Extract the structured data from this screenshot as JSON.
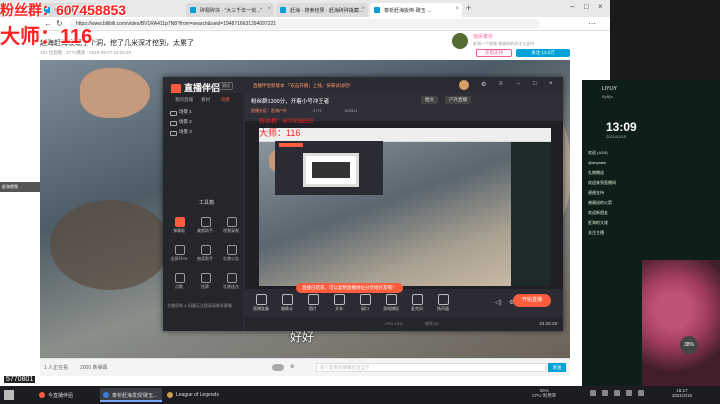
{
  "overlay": {
    "fans_text": "粉丝群：607458853",
    "master_text": "大师：116"
  },
  "browser": {
    "tabs": [
      {
        "label": "今日直播分社"
      },
      {
        "label": "碎裂砖块 · \"大三千年一剑...\""
      },
      {
        "label": "赶海 · 搜索结果 · 赶海砖碎撬藏..."
      },
      {
        "label": "泰祈赶海扳倒·碳玉·..."
      }
    ],
    "url": "https://www.bilibili.com/video/BV1RA411p7N8?from=search&seid=1948716631394097221"
  },
  "video": {
    "title": "赶海赶海发现了个洞，挖了几米深才挖到，太累了",
    "meta": "191 位观看 · 2771播放 · 2018-09-27 16:25:18",
    "uploader_name": "渔民泰祈",
    "uploader_desc": "赶海一个视频 感谢你的关注与支持",
    "charge_label": "充电支持",
    "follow_label": "关注 13.2万",
    "subtitle": "好好",
    "left_badge": "赶海视频",
    "footer_online": "1 人正在看",
    "footer_danmaku": "2000 条弹幕",
    "danmaku_placeholder": "发个友善的弹幕见证当下",
    "send_label": "发送"
  },
  "app": {
    "logo": "直播伴侣",
    "version": "测试",
    "notice": "直播伴侣新版本 「双击开播」上线，快来试试吧！",
    "sidebar_tabs": [
      "我的直播",
      "素材",
      "场景"
    ],
    "scenes": [
      "场景 1",
      "场景 2",
      "场景 3"
    ],
    "tools_title": "工具箱",
    "tools": [
      {
        "label": "弹幕姬"
      },
      {
        "label": "美颜助手"
      },
      {
        "label": "视频录制"
      },
      {
        "label": "全屏开PK"
      },
      {
        "label": "抽奖助手"
      },
      {
        "label": "礼物公告"
      },
      {
        "label": "点歌"
      },
      {
        "label": "投票"
      },
      {
        "label": "礼物连击"
      }
    ],
    "side_hint": "主播须知 & 如遇无法登录请联系客服",
    "room_line": "粉丝群1300分，开着小号冲王者",
    "room_chip_1": "图文",
    "room_chip_2": "户外直播",
    "room_sub_1": "直播分区：赶海户外",
    "room_sub_2": "2771",
    "room_sub_3": "529111",
    "toolbar": [
      "直播准备",
      "摄像头",
      "图片",
      "文本",
      "窗口",
      "游戏捕捉",
      "麦克风",
      "扬声器"
    ],
    "go_live": "开始直播",
    "toast": "直播已结束，可以复制直播地址分享给好友哦！",
    "status_cpu": "CPU:10%",
    "status_fps": "帧率:30",
    "status_time": "04:25:29"
  },
  "right_panel": {
    "name": "LIYLIY",
    "sub": "ByBjlx",
    "time": "13:09",
    "date": "2021/02/15",
    "chat": [
      "欢迎 (4/19)",
      "@ahyates",
      "礼物赠送",
      "欢迎来到直播间",
      "谢谢支持",
      "感谢送的火箭",
      "欢迎新朋友",
      "赶海的大佬",
      "关注主播"
    ],
    "percent": "38%"
  },
  "taskbar": {
    "tasks": [
      {
        "label": "今直播伴侣"
      },
      {
        "label": "泰祈赶海发现'碳玉..."
      },
      {
        "label": "League of Legends"
      }
    ],
    "cpu": "26%",
    "cpu_label": "CPU 利用率",
    "clock_time": "15:17",
    "clock_date": "2021/2/15"
  },
  "side_number": "5770801"
}
